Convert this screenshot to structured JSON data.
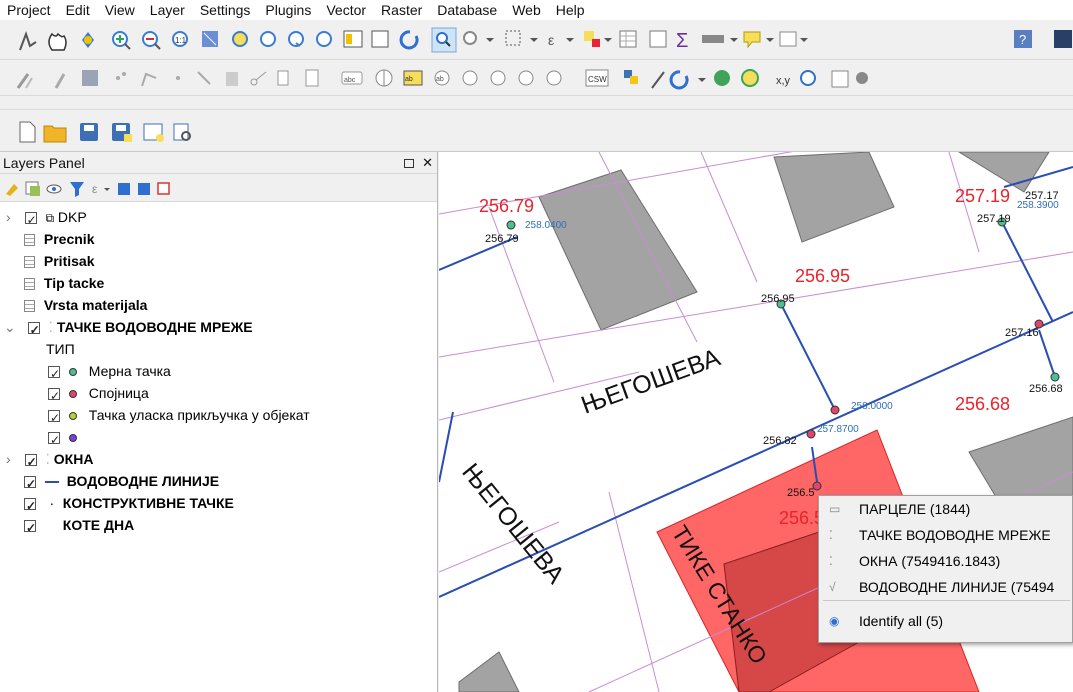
{
  "menu": [
    "Project",
    "Edit",
    "View",
    "Layer",
    "Settings",
    "Plugins",
    "Vector",
    "Raster",
    "Database",
    "Web",
    "Help"
  ],
  "layers_panel": {
    "title": "Layers Panel",
    "float_icon": "float-icon",
    "close_icon": "✕"
  },
  "layers": [
    {
      "label": "DKP",
      "bold": false,
      "type": "group"
    },
    {
      "label": "Precnik",
      "bold": true,
      "type": "table"
    },
    {
      "label": "Pritisak",
      "bold": true,
      "type": "table"
    },
    {
      "label": "Tip tacke",
      "bold": true,
      "type": "table"
    },
    {
      "label": "Vrsta materijala",
      "bold": true,
      "type": "table"
    },
    {
      "label": "ТАЧКЕ ВОДОВОДНЕ МРЕЖЕ",
      "bold": true,
      "type": "point"
    },
    {
      "label": "ТИП",
      "bold": false,
      "type": "header"
    },
    {
      "label": "Мерна тачка",
      "bold": false,
      "type": "class",
      "color": "#4dbf8f"
    },
    {
      "label": "Спојница",
      "bold": false,
      "type": "class",
      "color": "#e0456b"
    },
    {
      "label": "Тачка уласка прикључка у објекат",
      "bold": false,
      "type": "class",
      "color": "#b5d334"
    },
    {
      "label": "",
      "bold": false,
      "type": "class",
      "color": "#7a3fd6"
    },
    {
      "label": "ОКНА",
      "bold": true,
      "type": "point"
    },
    {
      "label": "ВОДОВОДНЕ ЛИНИЈЕ",
      "bold": true,
      "type": "line"
    },
    {
      "label": "КОНСТРУКТИВНЕ ТАЧКЕ",
      "bold": true,
      "type": "point"
    },
    {
      "label": "КОТЕ ДНА",
      "bold": true,
      "type": "none"
    }
  ],
  "map": {
    "street_labels": [
      "ЊЕГОШЕВА",
      "ЊЕГОШЕВА",
      "ТИКЕ СТАНКО"
    ],
    "elevation_labels": [
      "256.79",
      "256.95",
      "257.19",
      "256.68",
      "256.5"
    ],
    "point_labels": [
      "256.79",
      "256.95",
      "257.17",
      "257.19",
      "257.16",
      "256.68",
      "256.82",
      "256.5"
    ],
    "blue_labels": [
      "258.0400",
      "258.3900",
      "258.0000",
      "257.8700"
    ],
    "colors": {
      "parcel_line": "#c98bd4",
      "water_line": "#2a4db3",
      "building": "#a3a3a3",
      "highlight": "#ff4b4b",
      "elevation": "#e8232b"
    }
  },
  "context_menu": {
    "items": [
      {
        "icon": "parcel-icon",
        "label": "ПАРЦЕЛЕ (1844)"
      },
      {
        "icon": "point-layer-icon",
        "label": "ТАЧКЕ ВОДОВОДНЕ МРЕЖЕ"
      },
      {
        "icon": "point-layer-icon",
        "label": "ОКНА (7549416.1843)"
      },
      {
        "icon": "line-layer-icon",
        "label": "ВОДОВОДНЕ ЛИНИЈЕ (75494"
      },
      {
        "icon": "identify-icon",
        "label": "Identify all (5)"
      }
    ]
  }
}
